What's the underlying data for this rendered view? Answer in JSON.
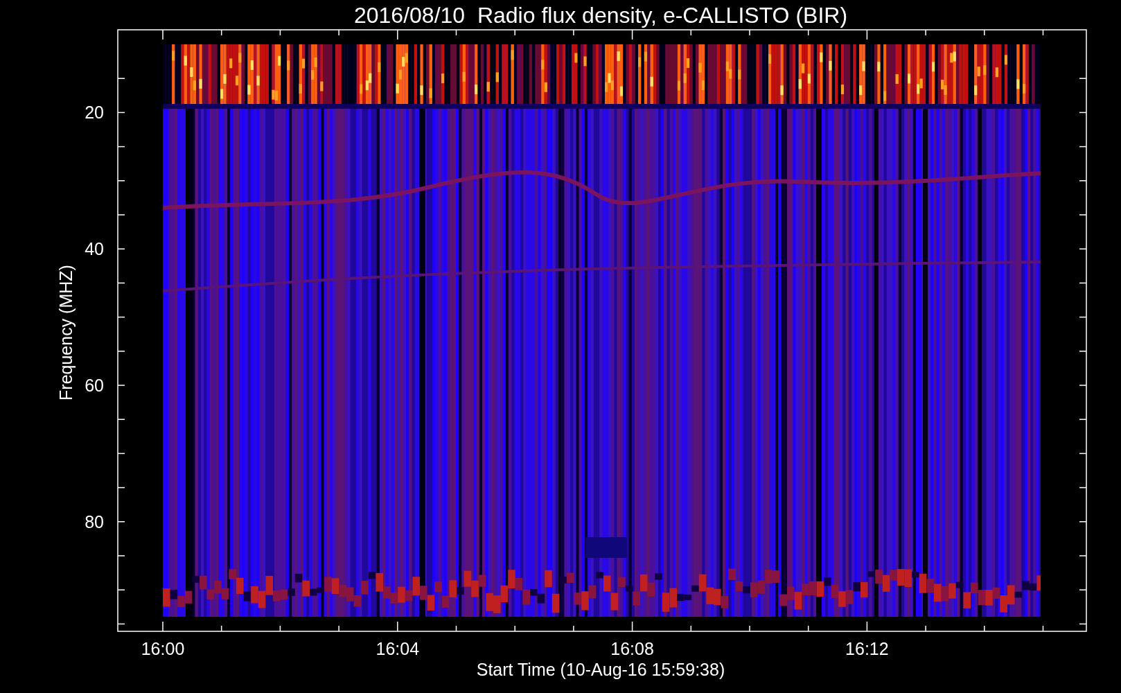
{
  "plot": {
    "title": "2016/08/10  Radio flux density, e-CALLISTO (BIR)",
    "xlabel": "Start Time (10-Aug-16 15:59:38)",
    "ylabel": "Frequency (MHZ)",
    "xtick_labels": [
      "16:00",
      "16:04",
      "16:08",
      "16:12"
    ],
    "ytick_labels": [
      "20",
      "40",
      "60",
      "80"
    ]
  }
}
